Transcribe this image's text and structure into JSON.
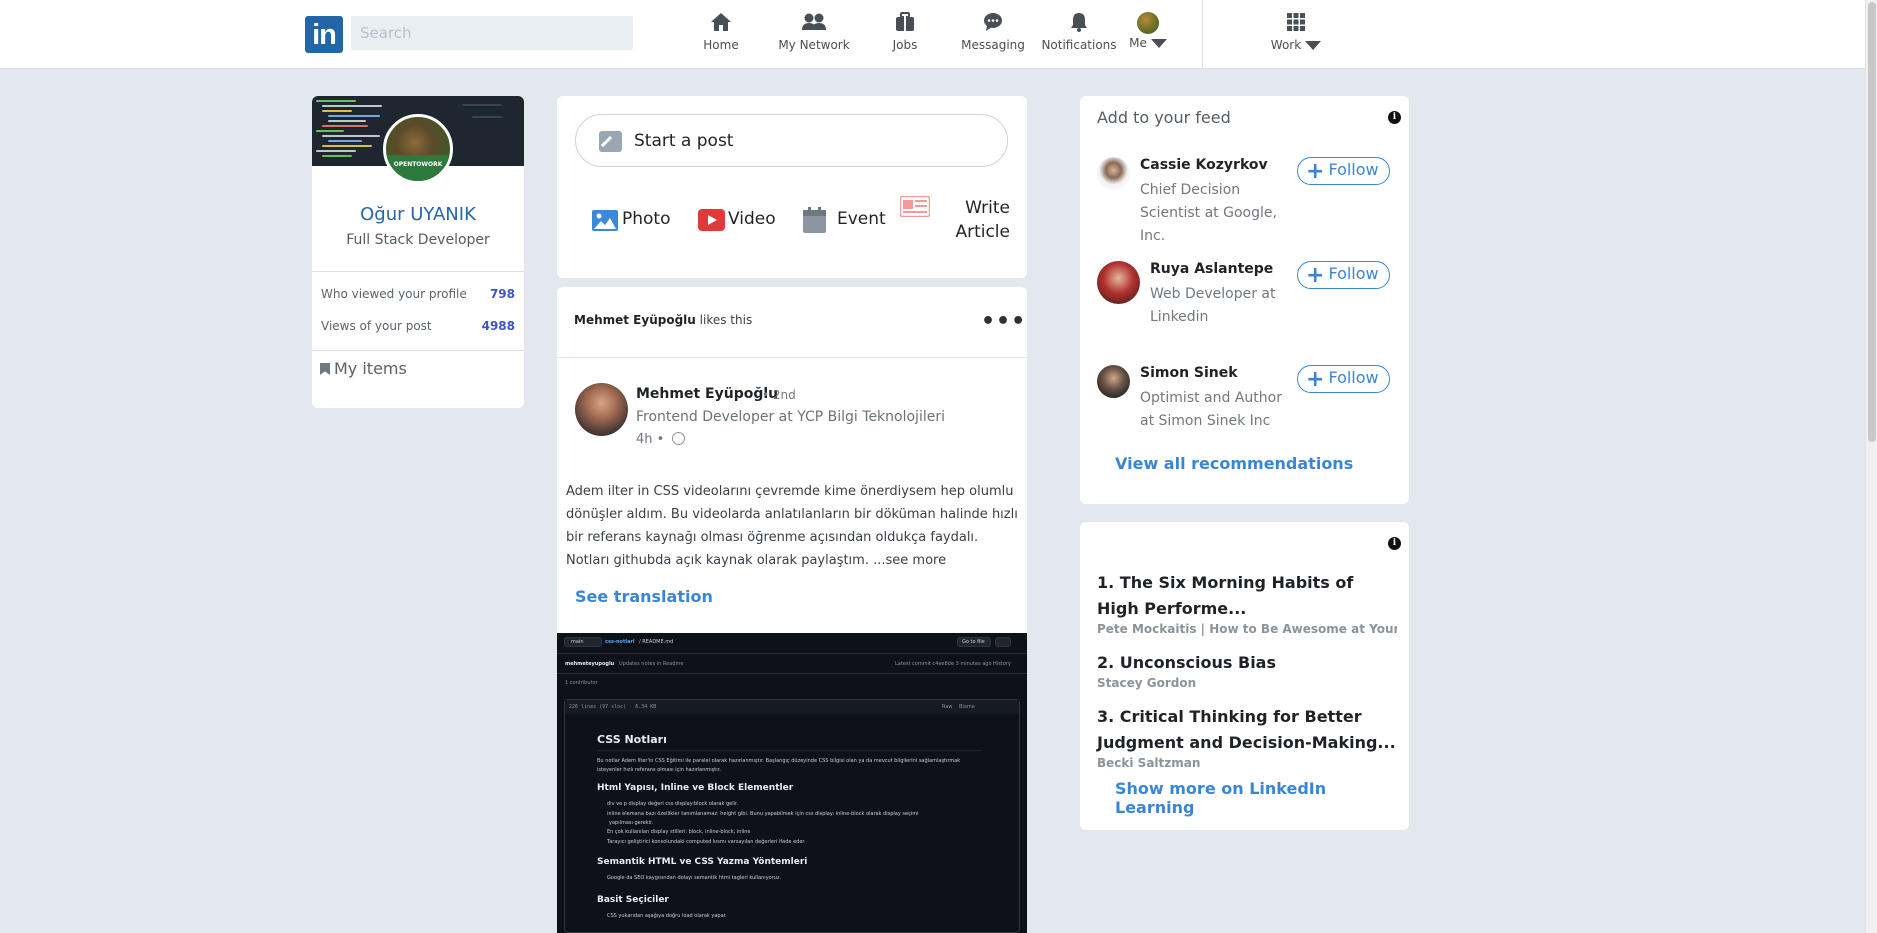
{
  "nav": {
    "logo_text": "in",
    "search_placeholder": "Search",
    "items": [
      {
        "label": "Home",
        "icon": "home-icon"
      },
      {
        "label": "My Network",
        "icon": "people-icon"
      },
      {
        "label": "Jobs",
        "icon": "briefcase-icon"
      },
      {
        "label": "Messaging",
        "icon": "chat-bubble-icon"
      },
      {
        "label": "Notifications",
        "icon": "bell-icon"
      },
      {
        "label": "Me",
        "icon": "avatar"
      }
    ],
    "work_label": "Work"
  },
  "profile": {
    "name": "Oğur UYANIK",
    "title": "Full Stack Developer",
    "avatar_badge": "OPENTOWORK",
    "stats": [
      {
        "label": "Who viewed your profile",
        "value": "798"
      },
      {
        "label": "Views of your post",
        "value": "4988"
      }
    ],
    "my_items": "My items"
  },
  "composer": {
    "start_post": "Start a post",
    "actions": {
      "photo": "Photo",
      "video": "Video",
      "event": "Event",
      "article_line1": "Write",
      "article_line2": "Article"
    }
  },
  "post": {
    "liker": "Mehmet Eyüpoğlu",
    "likes_this": "likes this",
    "more": "•••",
    "author": {
      "name": "Mehmet Eyüpoğlu",
      "degree": "• 2nd",
      "title": "Frontend Developer at YCP Bilgi Teknolojileri",
      "time": "4h •"
    },
    "body": "Adem ilter in CSS videolarını çevremde kime önerdiysem hep olumlu dönüşler aldım. Bu videolarda anlatılanların bir döküman halinde hızlı bir referans kaynağı olması öğrenme açısından oldukça faydalı. Notları githubda açık kaynak olarak paylaştım. ",
    "see_more": "...see more",
    "see_translation": "See translation",
    "image": {
      "branch": "main",
      "path_repo": "css-notlari",
      "path_file": "/ README.md",
      "go_to_file": "Go to file",
      "commit_user": "mehmeteyupoglu",
      "commit_msg": "Updates notes in Readme",
      "latest_commit": "Latest commit c4ee8de 3 minutes ago",
      "history": "History",
      "contributors": "1 contributor",
      "file_stats": "226 lines (97 sloc) · 6.34 KB",
      "raw": "Raw",
      "blame": "Blame",
      "h1": "CSS Notları",
      "intro_line1": "Bu notlar Adem Ilter'in CSS Eğitimi ile paralel olarak hazırlanmıştır. Başlangıç düzeyinde CSS bilgisi olan ya da mevcut bilgilerini sağlamlaştırmak",
      "intro_line2": "isteyenler hızlı referans olması için hazırlanmıştır.",
      "h2_1": "Html Yapısı, Inline ve Block Elementler",
      "li_1": "div ve p display değeri css display:block olarak gelir.",
      "li_2": "inline elemana bazı özellikler tanımlanamaz: height gibi. Bunu yapabilmek için css display: inline-block olarak display seçimi",
      "li_2b": "yapılması gerekir.",
      "li_3": "En çok kullanılan display stilleri: block, inline-block, inline",
      "li_4": "Tarayıcı geliştirici konsolundaki computed kısmı varsayılan değerleri ifade eder.",
      "h2_2": "Semantik HTML ve CSS Yazma Yöntemleri",
      "li_5": "Google da SEO kaygısından dolayı semantik html tagleri kullanıyoruz.",
      "h2_3": "Basit Seçiciler",
      "li_6": "CSS yukarıdan aşağıya doğru load olarak yapar."
    }
  },
  "feed_card": {
    "title": "Add to your feed",
    "follow_label": "Follow",
    "recommendations": [
      {
        "name": "Cassie Kozyrkov",
        "desc": "Chief Decision Scientist at Google, Inc."
      },
      {
        "name": "Ruya Aslantepe",
        "desc": "Web Developer at Linkedin"
      },
      {
        "name": "Simon Sinek",
        "desc": "Optimist and Author at Simon Sinek Inc"
      }
    ],
    "view_all": "View all recommendations"
  },
  "learning_card": {
    "courses": [
      {
        "title": "1. The Six Morning Habits of High Performe...",
        "author": "Pete Mockaitis | How to Be Awesome at Your Job..."
      },
      {
        "title": "2. Unconscious Bias",
        "author": "Stacey Gordon"
      },
      {
        "title": "3. Critical Thinking for Better Judgment and Decision-Making...",
        "author": "Becki Saltzman"
      }
    ],
    "show_more": "Show more on LinkedIn Learning"
  },
  "colors": {
    "brand": "#2266a8",
    "link": "#3a86d6",
    "page_bg": "#e2e8ee"
  }
}
